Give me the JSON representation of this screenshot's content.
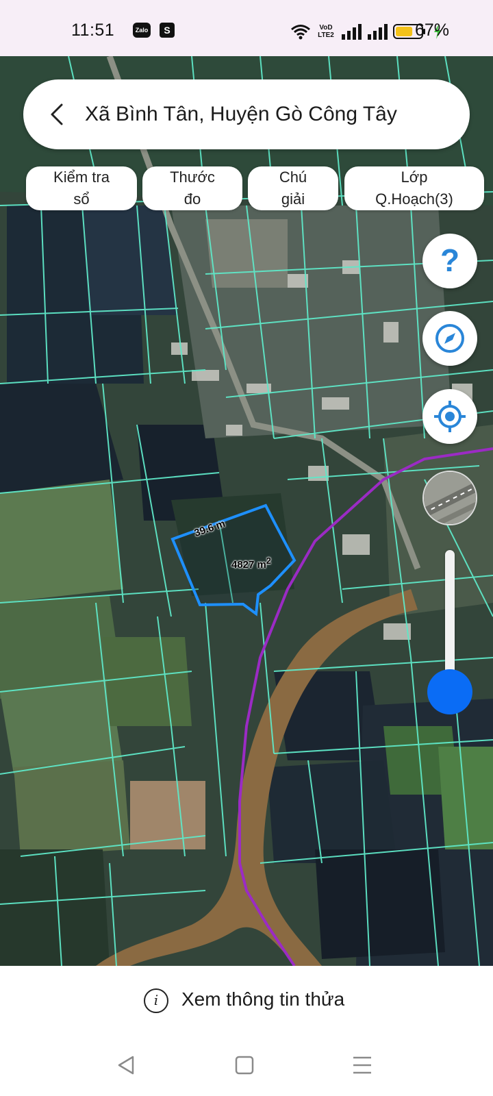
{
  "status_bar": {
    "time": "11:51",
    "apps": [
      "Zalo",
      "S"
    ],
    "network_label": "VoD LTE2",
    "battery_percent": "67%",
    "battery_level": 0.67
  },
  "header": {
    "title": "Xã Bình Tân, Huyện Gò Công Tây",
    "back_icon": "chevron-left-icon"
  },
  "chips": [
    {
      "line1": "Kiểm tra",
      "line2": "sổ"
    },
    {
      "line1": "Thước",
      "line2": "đo"
    },
    {
      "line1": "Chú",
      "line2": "giải"
    },
    {
      "line1": "Lớp",
      "line2": "Q.Hoạch(3)"
    }
  ],
  "map": {
    "parcel": {
      "edge_length": "39.6 m",
      "area_value": "4827 m",
      "area_unit_sup": "2",
      "outline_color": "#1e90ff"
    },
    "boundary_color": "#5fe8c8",
    "planning_line_color": "#9b2bc4"
  },
  "controls": {
    "help_icon": "question-icon",
    "compass_icon": "compass-icon",
    "locate_icon": "locate-icon",
    "layer_icon": "layer-thumbnail",
    "zoom_level": 0.1,
    "accent": "#0a6cf5"
  },
  "info_bar": {
    "label": "Xem thông tin thửa",
    "icon": "info-icon"
  },
  "nav": {
    "back": "back-triangle-icon",
    "home": "home-square-icon",
    "recents": "menu-lines-icon"
  }
}
